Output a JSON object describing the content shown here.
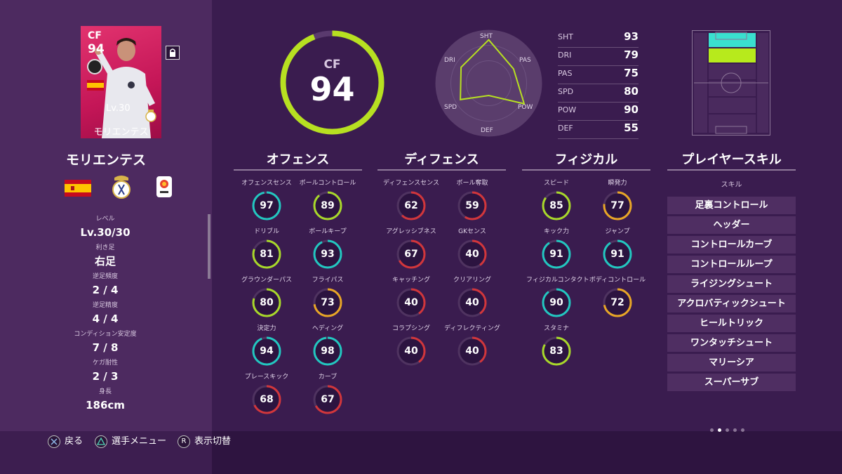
{
  "card": {
    "position": "CF",
    "overall": "94",
    "level": "Lv.30",
    "name": "モリエンテス",
    "card_color": "#d0235f"
  },
  "player_name": "モリエンテス",
  "info": [
    {
      "label": "レベル",
      "value": "Lv.30/30"
    },
    {
      "label": "利き足",
      "value": "右足"
    },
    {
      "label": "逆足頻度",
      "value": "2 / 4"
    },
    {
      "label": "逆足精度",
      "value": "4 / 4"
    },
    {
      "label": "コンディション安定度",
      "value": "7 / 8"
    },
    {
      "label": "ケガ耐性",
      "value": "2 / 3"
    },
    {
      "label": "身長",
      "value": "186cm"
    }
  ],
  "main": {
    "position": "CF",
    "overall": "94",
    "ring_fill": 0.94,
    "ring_color": "#b7e021"
  },
  "radar_labels": {
    "sht": "SHT",
    "pas": "PAS",
    "pow": "POW",
    "def": "DEF",
    "spd": "SPD",
    "dri": "DRI"
  },
  "summary_stats": [
    {
      "name": "SHT",
      "value": 93
    },
    {
      "name": "DRI",
      "value": 79
    },
    {
      "name": "PAS",
      "value": 75
    },
    {
      "name": "SPD",
      "value": 80
    },
    {
      "name": "POW",
      "value": 90
    },
    {
      "name": "DEF",
      "value": 55
    }
  ],
  "sections": {
    "offense": "オフェンス",
    "defense": "ディフェンス",
    "physical": "フィジカル",
    "skills": "プレイヤースキル"
  },
  "offense": [
    {
      "label": "オフェンスセンス",
      "value": 97
    },
    {
      "label": "ボールコントロール",
      "value": 89
    },
    {
      "label": "ドリブル",
      "value": 81
    },
    {
      "label": "ボールキープ",
      "value": 93
    },
    {
      "label": "グラウンダーパス",
      "value": 80
    },
    {
      "label": "フライパス",
      "value": 73
    },
    {
      "label": "決定力",
      "value": 94
    },
    {
      "label": "ヘディング",
      "value": 98
    },
    {
      "label": "プレースキック",
      "value": 68
    },
    {
      "label": "カーブ",
      "value": 67
    }
  ],
  "defense": [
    {
      "label": "ディフェンスセンス",
      "value": 62
    },
    {
      "label": "ボール奪取",
      "value": 59
    },
    {
      "label": "アグレッシブネス",
      "value": 67
    },
    {
      "label": "GKセンス",
      "value": 40
    },
    {
      "label": "キャッチング",
      "value": 40
    },
    {
      "label": "クリアリング",
      "value": 40
    },
    {
      "label": "コラプシング",
      "value": 40
    },
    {
      "label": "ディフレクティング",
      "value": 40
    }
  ],
  "physical": [
    {
      "label": "スピード",
      "value": 85
    },
    {
      "label": "瞬発力",
      "value": 77
    },
    {
      "label": "キック力",
      "value": 91
    },
    {
      "label": "ジャンプ",
      "value": 91
    },
    {
      "label": "フィジカルコンタクト",
      "value": 90
    },
    {
      "label": "ボディコントロール",
      "value": 72
    },
    {
      "label": "スタミナ",
      "value": 83
    }
  ],
  "skills_sub": "スキル",
  "skills": [
    "足裏コントロール",
    "ヘッダー",
    "コントロールカーブ",
    "コントロールループ",
    "ライジングシュート",
    "アクロバティックシュート",
    "ヒールトリック",
    "ワンタッチシュート",
    "マリーシア",
    "スーパーサブ"
  ],
  "controls": {
    "back": "戻る",
    "menu": "選手メニュー",
    "toggle": "表示切替",
    "r_button": "R"
  },
  "colors": {
    "high": "#22c7c0",
    "good": "#a8d82a",
    "mid": "#e8a626",
    "low": "#d2363b"
  }
}
